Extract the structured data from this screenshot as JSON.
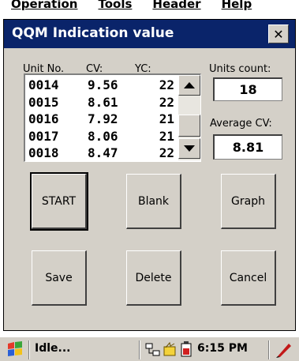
{
  "background_menu": {
    "items": [
      "Operation",
      "Tools",
      "Header",
      "Help"
    ]
  },
  "dialog": {
    "title": "QQM Indication value",
    "close_label": "✕"
  },
  "list": {
    "headers": {
      "unit": "Unit No.",
      "cv": "CV:",
      "yc": "YC:"
    },
    "rows": [
      {
        "unit": "0014",
        "cv": "9.56",
        "yc": "22"
      },
      {
        "unit": "0015",
        "cv": "8.61",
        "yc": "22"
      },
      {
        "unit": "0016",
        "cv": "7.92",
        "yc": "21"
      },
      {
        "unit": "0017",
        "cv": "8.06",
        "yc": "21"
      },
      {
        "unit": "0018",
        "cv": "8.47",
        "yc": "22"
      }
    ]
  },
  "stats": {
    "units_count_label": "Units count:",
    "units_count_value": "18",
    "average_cv_label": "Average CV:",
    "average_cv_value": "8.81"
  },
  "buttons": {
    "start": "START",
    "blank": "Blank",
    "graph": "Graph",
    "save": "Save",
    "delete": "Delete",
    "cancel": "Cancel"
  },
  "taskbar": {
    "status": "Idle...",
    "time": "6:15 PM",
    "icons": [
      "windows-flag-icon",
      "network-icon",
      "battery-icon",
      "power-icon",
      "pen-icon"
    ]
  },
  "colors": {
    "titlebar": "#0a246a",
    "dialog_face": "#d4d0c8"
  }
}
